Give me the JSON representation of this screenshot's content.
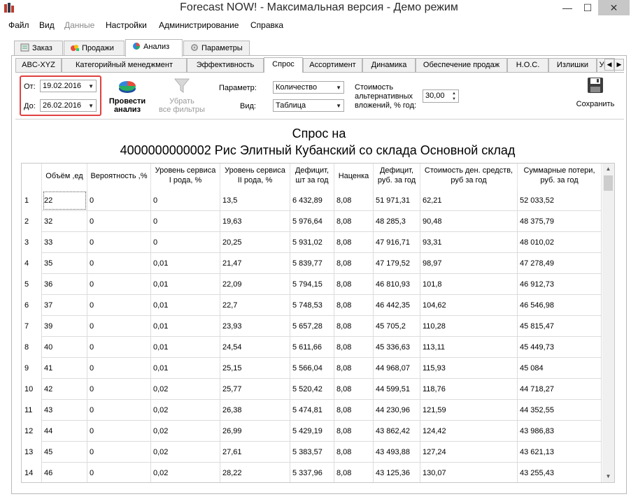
{
  "window": {
    "title": "Forecast NOW! - Максимальная версия - Демо режим",
    "minimize": "—",
    "maximize": "☐",
    "close": "✕"
  },
  "menu": [
    {
      "label": "Файл",
      "disabled": false
    },
    {
      "label": "Вид",
      "disabled": false
    },
    {
      "label": "Данные",
      "disabled": true
    },
    {
      "label": "Настройки",
      "disabled": false
    },
    {
      "label": "Администрирование",
      "disabled": false
    },
    {
      "label": "Справка",
      "disabled": false
    }
  ],
  "top_tabs": [
    {
      "label": "Заказ",
      "icon": "order-icon"
    },
    {
      "label": "Продажи",
      "icon": "sales-icon"
    },
    {
      "label": "Анализ",
      "icon": "pie-chart-icon",
      "active": true
    },
    {
      "label": "Параметры",
      "icon": "gear-icon"
    }
  ],
  "sub_tabs": [
    "ABC-XYZ",
    "Категорийный менеджмент",
    "Эффективность",
    "Спрос",
    "Ассортимент",
    "Динамика",
    "Обеспечение продаж",
    "Н.О.С.",
    "Излишки",
    "Уро"
  ],
  "sub_tab_active": "Спрос",
  "toolbar": {
    "from_label": "От:",
    "from_value": "19.02.2016",
    "to_label": "До:",
    "to_value": "26.02.2016",
    "run_line1": "Провести",
    "run_line2": "анализ",
    "clear_line1": "Убрать",
    "clear_line2": "все фильтры",
    "param_label": "Параметр:",
    "param_value": "Количество",
    "view_label": "Вид:",
    "view_value": "Таблица",
    "cost_line1": "Стоимость",
    "cost_line2": "альтернативных",
    "cost_line3": "вложений, % год:",
    "cost_value": "30,00",
    "save_label": "Сохранить"
  },
  "heading": {
    "line1": "Спрос на",
    "line2": "4000000000002 Рис Элитный Кубанский со склада Основной склад"
  },
  "table": {
    "columns": [
      [
        "Объём ,ед",
        ""
      ],
      [
        "Вероятность ,%",
        ""
      ],
      [
        "Уровень сервиса",
        "I рода, %"
      ],
      [
        "Уровень сервиса",
        "II рода, %"
      ],
      [
        "Дефицит,",
        "шт за год"
      ],
      [
        "Наценка",
        ""
      ],
      [
        "Дефицит,",
        "руб. за год"
      ],
      [
        "Стоимость ден. средств,",
        "руб за год"
      ],
      [
        "Суммарные потери,",
        "руб. за год"
      ]
    ],
    "rows": [
      [
        "1",
        "22",
        "0",
        "0",
        "13,5",
        "6 432,89",
        "8,08",
        "51 971,31",
        "62,21",
        "52 033,52"
      ],
      [
        "2",
        "32",
        "0",
        "0",
        "19,63",
        "5 976,64",
        "8,08",
        "48 285,3",
        "90,48",
        "48 375,79"
      ],
      [
        "3",
        "33",
        "0",
        "0",
        "20,25",
        "5 931,02",
        "8,08",
        "47 916,71",
        "93,31",
        "48 010,02"
      ],
      [
        "4",
        "35",
        "0",
        "0,01",
        "21,47",
        "5 839,77",
        "8,08",
        "47 179,52",
        "98,97",
        "47 278,49"
      ],
      [
        "5",
        "36",
        "0",
        "0,01",
        "22,09",
        "5 794,15",
        "8,08",
        "46 810,93",
        "101,8",
        "46 912,73"
      ],
      [
        "6",
        "37",
        "0",
        "0,01",
        "22,7",
        "5 748,53",
        "8,08",
        "46 442,35",
        "104,62",
        "46 546,98"
      ],
      [
        "7",
        "39",
        "0",
        "0,01",
        "23,93",
        "5 657,28",
        "8,08",
        "45 705,2",
        "110,28",
        "45 815,47"
      ],
      [
        "8",
        "40",
        "0",
        "0,01",
        "24,54",
        "5 611,66",
        "8,08",
        "45 336,63",
        "113,11",
        "45 449,73"
      ],
      [
        "9",
        "41",
        "0",
        "0,01",
        "25,15",
        "5 566,04",
        "8,08",
        "44 968,07",
        "115,93",
        "45 084"
      ],
      [
        "10",
        "42",
        "0",
        "0,02",
        "25,77",
        "5 520,42",
        "8,08",
        "44 599,51",
        "118,76",
        "44 718,27"
      ],
      [
        "11",
        "43",
        "0",
        "0,02",
        "26,38",
        "5 474,81",
        "8,08",
        "44 230,96",
        "121,59",
        "44 352,55"
      ],
      [
        "12",
        "44",
        "0",
        "0,02",
        "26,99",
        "5 429,19",
        "8,08",
        "43 862,42",
        "124,42",
        "43 986,83"
      ],
      [
        "13",
        "45",
        "0",
        "0,02",
        "27,61",
        "5 383,57",
        "8,08",
        "43 493,88",
        "127,24",
        "43 621,13"
      ],
      [
        "14",
        "46",
        "0",
        "0,02",
        "28,22",
        "5 337,96",
        "8,08",
        "43 125,36",
        "130,07",
        "43 255,43"
      ]
    ]
  },
  "colors": {
    "highlight_border": "#e04040",
    "tab_border": "#b8b8b8",
    "grid_line": "#dcdcdc"
  }
}
